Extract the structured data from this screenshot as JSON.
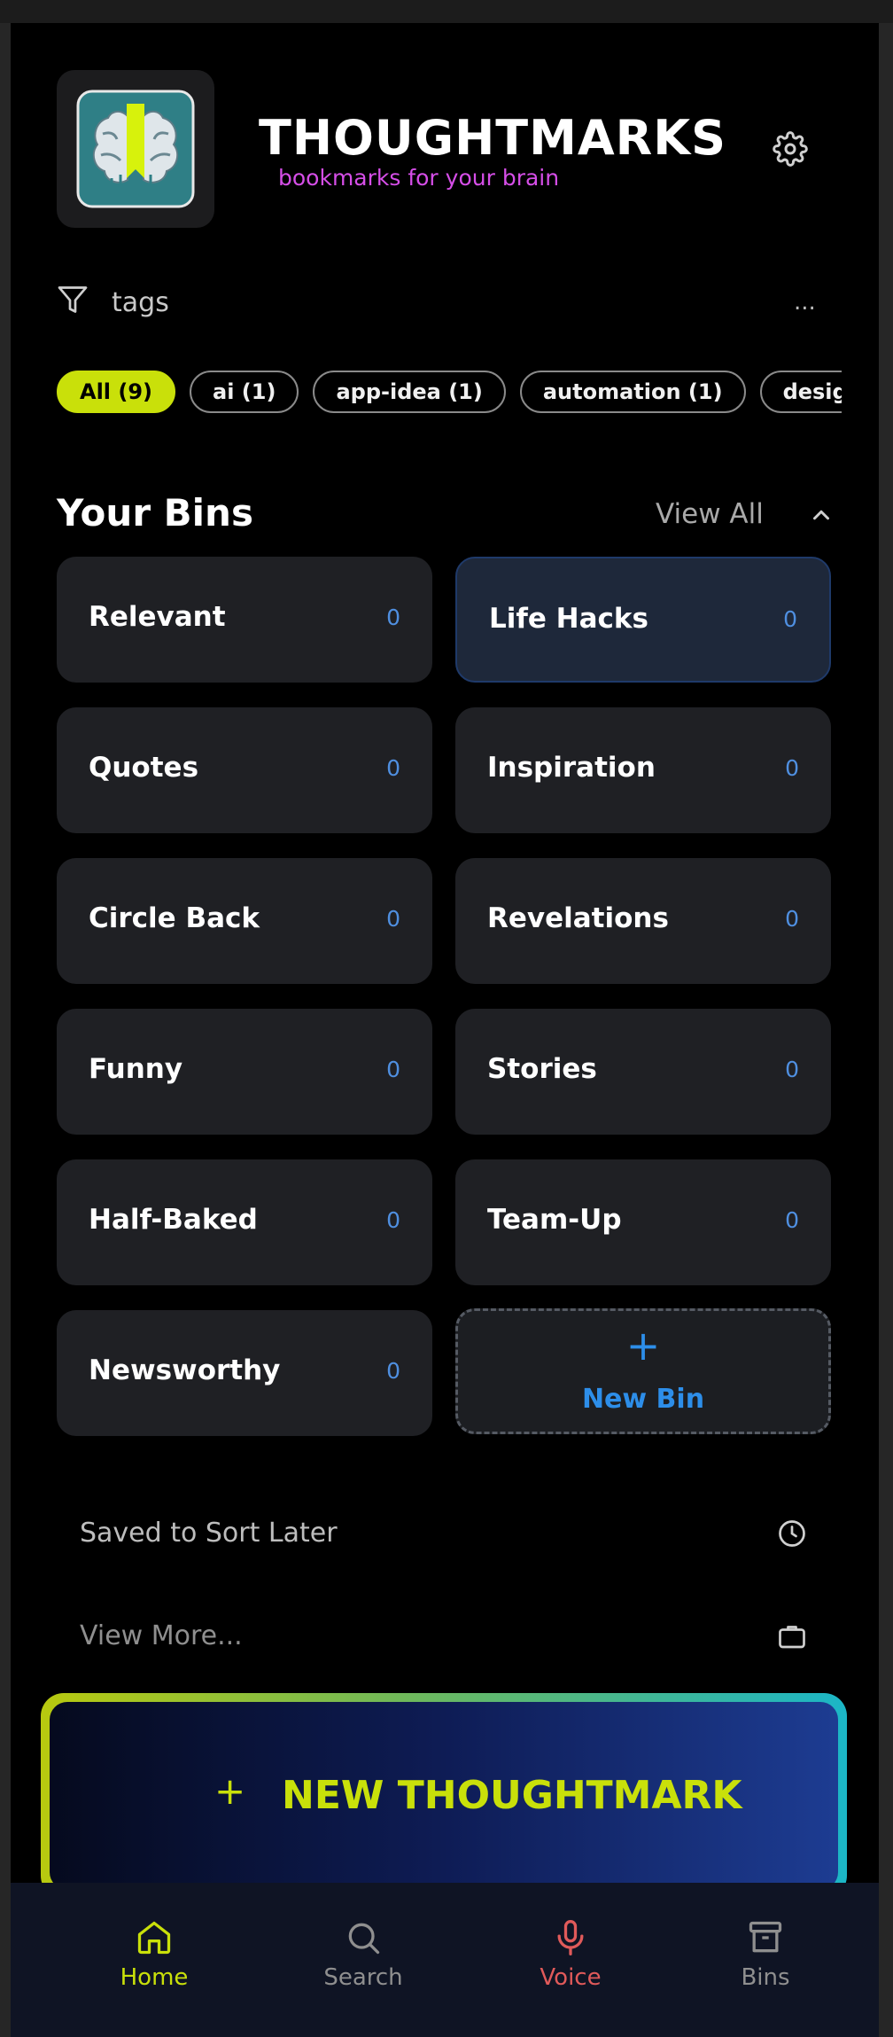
{
  "app": {
    "title": "THOUGHTMARKS",
    "subtitle": "bookmarks for your brain",
    "colors": {
      "accent": "#c9e00a",
      "link": "#2d8ee9",
      "subtitle": "#d64ee8",
      "voice": "#e05a5a"
    }
  },
  "header": {
    "logo_icon": "brain-bookmark-logo",
    "settings_icon": "gear-icon"
  },
  "tags": {
    "label": "tags",
    "more": "...",
    "chips": [
      {
        "label": "All (9)",
        "active": true
      },
      {
        "label": "ai (1)",
        "active": false
      },
      {
        "label": "app-idea (1)",
        "active": false
      },
      {
        "label": "automation (1)",
        "active": false
      },
      {
        "label": "design-p",
        "active": false
      }
    ]
  },
  "bins": {
    "title": "Your Bins",
    "view_all": "View All",
    "items": [
      {
        "name": "Relevant",
        "count": "0"
      },
      {
        "name": "Life Hacks",
        "count": "0"
      },
      {
        "name": "Quotes",
        "count": "0"
      },
      {
        "name": "Inspiration",
        "count": "0"
      },
      {
        "name": "Circle Back",
        "count": "0"
      },
      {
        "name": "Revelations",
        "count": "0"
      },
      {
        "name": "Funny",
        "count": "0"
      },
      {
        "name": "Stories",
        "count": "0"
      },
      {
        "name": "Half-Baked",
        "count": "0"
      },
      {
        "name": "Team-Up",
        "count": "0"
      },
      {
        "name": "Newsworthy",
        "count": "0"
      }
    ],
    "new_bin_plus": "+",
    "new_bin_label": "New Bin"
  },
  "links": {
    "saved": "Saved to Sort Later",
    "view_more": "View More..."
  },
  "new_thoughtmark": {
    "plus": "+",
    "label": "NEW THOUGHTMARK"
  },
  "nav": [
    {
      "label": "Home",
      "icon": "home-icon"
    },
    {
      "label": "Search",
      "icon": "search-icon"
    },
    {
      "label": "Voice",
      "icon": "mic-icon"
    },
    {
      "label": "Bins",
      "icon": "archive-icon"
    }
  ]
}
